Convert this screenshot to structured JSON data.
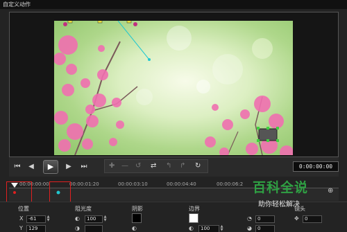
{
  "window": {
    "title": "自定义动作"
  },
  "transport": {
    "first_icon": "skip-start-icon",
    "prev_icon": "step-back-icon",
    "play_icon": "play-icon",
    "next_icon": "step-forward-icon",
    "last_icon": "skip-end-icon",
    "timecode": "0:00:00:00"
  },
  "timeline": {
    "ticks": [
      "00:00:00:00",
      "00:00:01:20",
      "00:00:03:10",
      "00:00:04:40",
      "00:00:06:2"
    ],
    "zoom_icon": "zoom-in-icon"
  },
  "properties": {
    "position": {
      "label": "位置",
      "x_label": "X",
      "x_value": "-61",
      "y_label": "Y",
      "y_value": "129"
    },
    "brightness": {
      "label": "阻光度",
      "value": "100"
    },
    "shadow": {
      "label": "阴影"
    },
    "border": {
      "label": "边界",
      "value": "100"
    },
    "rotation": {
      "values": [
        "0",
        "0",
        "0"
      ]
    },
    "partial_label": "镜头"
  },
  "watermark": {
    "main": "百科全说",
    "sub": "助你轻松解决"
  },
  "colors": {
    "accent_red": "#e02020",
    "watermark_green": "#2fa043"
  }
}
